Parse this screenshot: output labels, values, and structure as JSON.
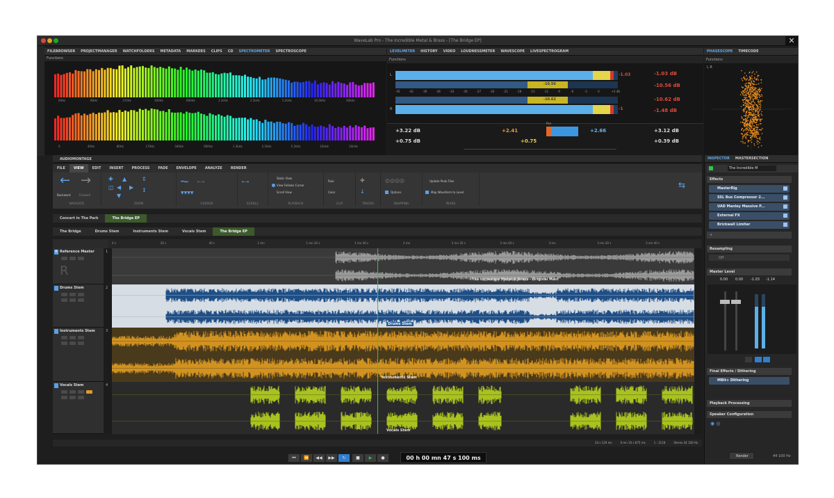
{
  "window": {
    "title": "WaveLab Pro - The Incredible Metal & Brass - [The Bridge EP]",
    "close_glyph": "✕"
  },
  "colors": {
    "accent": "#4a9ae0",
    "drums_wave": "#1f4f86",
    "instruments_wave": "#d1921f",
    "vocals_wave": "#a9c21f",
    "reference_wave": "#9a9a9a",
    "playhead": "#35c24d"
  },
  "top_left_tabs": [
    "FILEBROWSER",
    "PROJECTMANAGER",
    "WATCHFOLDERS",
    "METADATA",
    "MARKERS",
    "CLIPS",
    "CD",
    "SPECTROMETER",
    "SPECTROSCOPE"
  ],
  "top_left_active_tab": "SPECTROMETER",
  "spectro_functions": "Functions",
  "spectro_freq_top": [
    "60Hz",
    "80Hz",
    "170Hz",
    "300Hz",
    "660Hz",
    "1.2kHz",
    "2.5kHz",
    "5.2kHz",
    "10.0kHz",
    "20kHz"
  ],
  "spectro_freq_bottom": [
    "0",
    "40Hz",
    "80Hz",
    "170Hz",
    "340Hz",
    "660Hz",
    "1.3kHz",
    "2.5kHz",
    "5.2kHz",
    "10kHz",
    "20kHz"
  ],
  "top_mid_tabs": [
    "LEVELMETER",
    "HISTORY",
    "VIDEO",
    "LOUDNESSMETER",
    "WAVESCOPE",
    "LIVESPECTROGRAM"
  ],
  "top_mid_active_tab": "LEVELMETER",
  "level_functions": "Functions",
  "level_meter": {
    "peak_top": "-1.03 dB",
    "rms_top": "-10.56 dB",
    "rms_bottom": "-10.62 dB",
    "peak_bottom": "-1.48",
    "peak_bottom_right": "-1.48 dB",
    "scale": [
      "-45",
      "-42",
      "-39",
      "-36",
      "-33",
      "-30",
      "-27",
      "-24",
      "-21",
      "-18",
      "-15",
      "-12",
      "-9",
      "-6",
      "-3",
      "0",
      "+3 dB"
    ],
    "left_peak_fill": 0.93,
    "left_rms_fill": 0.6,
    "right_peak_fill": 0.93,
    "right_rms_fill": 0.6,
    "marker_small_top": "-1.03",
    "marker_small_bottom": "-1",
    "rms_inner_top": "-10.56",
    "rms_inner_bottom": "-10.62"
  },
  "level_readouts": {
    "left_a": "+3.22 dB",
    "left_b": "+0.75 dB",
    "center_a": "+2.41",
    "center_b": "+0.75",
    "center_c": "+2.66",
    "right_a": "+3.12 dB",
    "right_b": "+0.39 dB",
    "pan_label": "Pan",
    "pan_left_fill": 0.25,
    "pan_right_fill": 0.66
  },
  "top_right_tabs": [
    "PHASESCOPE",
    "TIMECODE"
  ],
  "top_right_active_tab": "PHASESCOPE",
  "phasescope_functions": "Functions",
  "phasescope_label": "L R",
  "montage": {
    "header": "AUDIOMONTAGE",
    "ribbon_tabs": [
      "FILE",
      "VIEW",
      "EDIT",
      "INSERT",
      "PROCESS",
      "FADE",
      "ENVELOPE",
      "ANALYZE",
      "RENDER"
    ],
    "active_ribbon_tab": "VIEW",
    "nav_back": "Backward",
    "nav_forward": "Forward",
    "groups": [
      "NAVIGATE",
      "ZOOM",
      "CURSOR",
      "SCROLL",
      "PLAYBACK",
      "CLIP",
      "TRACKS",
      "SNAPPING",
      "PEAKS"
    ],
    "playback_options": [
      "Static View",
      "View Follows Cursor",
      "Scroll View"
    ],
    "clip_options": [
      "Rule",
      "Color"
    ],
    "snapping_options": "Options",
    "peaks_options": [
      "Update Peak Files",
      "Map Waveform to Level"
    ],
    "doc_tabs": [
      "Concert in The Park",
      "The Bridge EP"
    ],
    "active_doc_tab": "The Bridge EP",
    "stem_tabs": [
      "The Bridge",
      "Drums Stem",
      "Instruments Stem",
      "Vocals Stem",
      "The Bridge EP"
    ],
    "active_stem_tab": "The Bridge EP",
    "ruler": [
      "0 s",
      "20 s",
      "40 s",
      "1 mn",
      "1 mn 20 s",
      "1 mn 40 s",
      "2 mn",
      "2 mn 20 s",
      "2 mn 40 s",
      "3 mn",
      "3 mn 20 s",
      "3 mn 40 s"
    ],
    "tracks": [
      {
        "name": "Reference Master",
        "number": "1",
        "clip_label": "The Incredible Metal & Brass - Original Mast"
      },
      {
        "name": "Drums Stem",
        "number": "2",
        "clip_label": "Drums Stem"
      },
      {
        "name": "Instruments Stem",
        "number": "3",
        "clip_label": "Instruments Stem"
      },
      {
        "name": "Vocals Stem",
        "number": "4",
        "clip_label": "Vocals Stem"
      }
    ],
    "status": [
      "24 s 129 ms",
      "0 mn 10 s 875 ms",
      "1 : 3118",
      "Stereo 44 100 Hz"
    ]
  },
  "transport": {
    "time": "00 h 00 mn 47 s 100 ms"
  },
  "inspector": {
    "tabs": [
      "INSPECTOR",
      "MASTERSECTION"
    ],
    "preset": "The Incredible M",
    "effects_label": "Effects",
    "effects": [
      "MasterRig",
      "SSL Bus Compressor 2...",
      "UAD Manley Massive P...",
      "External FX",
      "Brickwall Limiter"
    ],
    "resampling": "Resampling",
    "resampling_value": "Off",
    "master_level": "Master Level",
    "master_readouts": [
      "0.00",
      "0.00",
      "-1.03",
      "-1.14"
    ],
    "final_effects": "Final Effects / Dithering",
    "dithering": "MBit+ Dithering",
    "playback_processing": "Playback Processing",
    "speaker_config": "Speaker Configuration",
    "render": "Render",
    "sample_rate": "44 100 Hz"
  }
}
